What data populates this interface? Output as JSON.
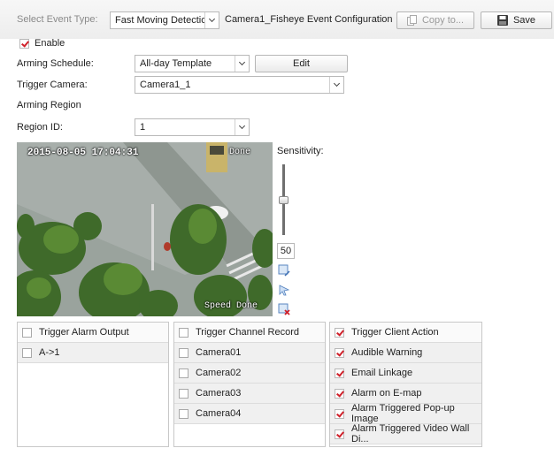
{
  "toolbar": {
    "event_type_label": "Select Event Type:",
    "event_type_value": "Fast Moving Detection",
    "config_title": "Camera1_Fisheye Event Configuration",
    "copy_label": "Copy to...",
    "save_label": "Save"
  },
  "form": {
    "enable_label": "Enable",
    "enable_checked": true,
    "arming_schedule_label": "Arming Schedule:",
    "arming_schedule_value": "All-day Template",
    "edit_label": "Edit",
    "trigger_camera_label": "Trigger Camera:",
    "trigger_camera_value": "Camera1_1",
    "arming_region_label": "Arming Region",
    "region_id_label": "Region ID:",
    "region_id_value": "1"
  },
  "video": {
    "timestamp": "2015-08-05 17:04:31",
    "top_right_text": "Done",
    "bottom_text": "Speed Done"
  },
  "sensitivity": {
    "label": "Sensitivity:",
    "value": "50",
    "level_percent": 50,
    "tools": [
      "draw-region-icon",
      "select-region-icon",
      "delete-region-icon"
    ]
  },
  "panels": {
    "alarm_output": {
      "header": "Trigger Alarm Output",
      "items": [
        {
          "label": "A->1",
          "checked": false
        }
      ]
    },
    "channel_record": {
      "header": "Trigger Channel Record",
      "items": [
        {
          "label": "Camera01",
          "checked": false
        },
        {
          "label": "Camera02",
          "checked": false
        },
        {
          "label": "Camera03",
          "checked": false
        },
        {
          "label": "Camera04",
          "checked": false
        }
      ]
    },
    "client_action": {
      "header": "Trigger Client Action",
      "header_checked": true,
      "items": [
        {
          "label": "Audible Warning",
          "checked": true
        },
        {
          "label": "Email Linkage",
          "checked": true
        },
        {
          "label": "Alarm on E-map",
          "checked": true
        },
        {
          "label": "Alarm Triggered Pop-up Image",
          "checked": true
        },
        {
          "label": "Alarm Triggered Video Wall Di...",
          "checked": true
        }
      ]
    }
  },
  "colors": {
    "check_mark": "#d0202a",
    "panel_border": "#c8c8c8"
  }
}
